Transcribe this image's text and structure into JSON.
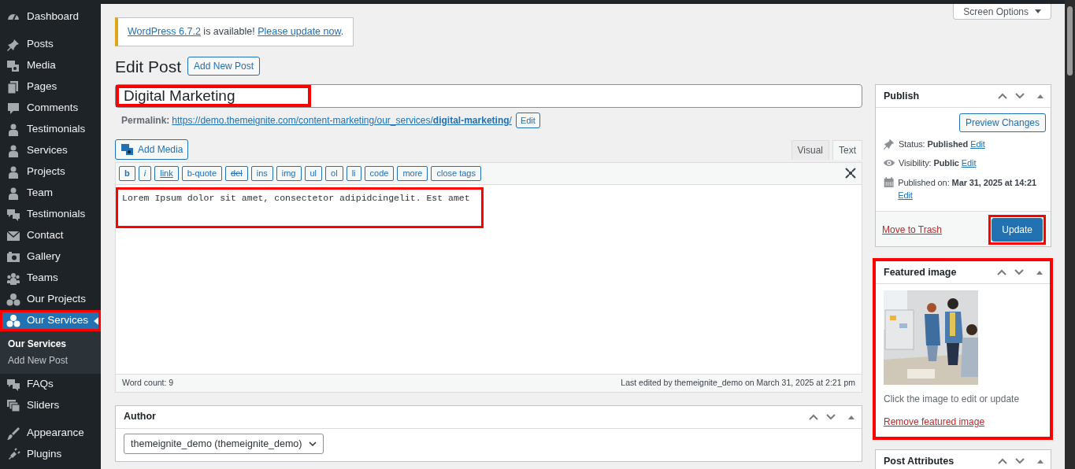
{
  "sidebar": {
    "items": [
      {
        "label": "Dashboard",
        "selected": false,
        "highlighted": false
      },
      {
        "label": "Posts",
        "selected": false,
        "highlighted": false
      },
      {
        "label": "Media",
        "selected": false,
        "highlighted": false
      },
      {
        "label": "Pages",
        "selected": false,
        "highlighted": false
      },
      {
        "label": "Comments",
        "selected": false,
        "highlighted": false
      },
      {
        "label": "Testimonials",
        "selected": false,
        "highlighted": false
      },
      {
        "label": "Services",
        "selected": false,
        "highlighted": false
      },
      {
        "label": "Projects",
        "selected": false,
        "highlighted": false
      },
      {
        "label": "Team",
        "selected": false,
        "highlighted": false
      },
      {
        "label": "Testimonials",
        "selected": false,
        "highlighted": false
      },
      {
        "label": "Contact",
        "selected": false,
        "highlighted": false
      },
      {
        "label": "Gallery",
        "selected": false,
        "highlighted": false
      },
      {
        "label": "Teams",
        "selected": false,
        "highlighted": false
      },
      {
        "label": "Our Projects",
        "selected": false,
        "highlighted": false
      },
      {
        "label": "Our Services",
        "selected": true,
        "highlighted": true,
        "children": [
          {
            "label": "Our Services",
            "selected": true
          },
          {
            "label": "Add New Post",
            "selected": false
          }
        ]
      },
      {
        "label": "FAQs",
        "selected": false,
        "highlighted": false
      },
      {
        "label": "Sliders",
        "selected": false,
        "highlighted": false
      },
      {
        "label": "Appearance",
        "selected": false,
        "highlighted": false
      },
      {
        "label": "Plugins",
        "selected": false,
        "highlighted": false
      }
    ]
  },
  "screen_options": "Screen Options",
  "notice": {
    "link_1": "WordPress 6.7.2",
    "text_1": "is available!",
    "link_2": "Please update now",
    "text_2": "."
  },
  "heading": "Edit Post",
  "add_new_button": "Add New Post",
  "title_field": {
    "value": "Digital Marketing",
    "highlighted": true
  },
  "permalink": {
    "label": "Permalink:",
    "url": "https://demo.themeignite.com/content-marketing/our_services/**digital-marketing**/",
    "edit_button": "Edit"
  },
  "editor": {
    "add_media": "Add Media",
    "tabs": [
      {
        "label": "Visual",
        "selected": false
      },
      {
        "label": "Text",
        "selected": true
      }
    ],
    "quicktags": [
      {
        "label": "b",
        "kind": "bold"
      },
      {
        "label": "i",
        "kind": "italic"
      },
      {
        "label": "link",
        "kind": "underline"
      },
      {
        "label": "b-quote",
        "kind": "plain"
      },
      {
        "label": "del",
        "kind": "strike"
      },
      {
        "label": "ins",
        "kind": "plain"
      },
      {
        "label": "img",
        "kind": "plain"
      },
      {
        "label": "ul",
        "kind": "plain"
      },
      {
        "label": "ol",
        "kind": "plain"
      },
      {
        "label": "li",
        "kind": "plain"
      },
      {
        "label": "code",
        "kind": "plain"
      },
      {
        "label": "more",
        "kind": "plain"
      },
      {
        "label": "close tags",
        "kind": "plain"
      }
    ],
    "content": "Lorem Ipsum dolor sit amet, consectetor adipidcingelit. Est amet",
    "content_highlighted": true,
    "word_count": "Word count: 9",
    "last_edited": "Last edited by themeignite_demo on March 31, 2025 at 2:21 pm"
  },
  "author": {
    "title": "Author",
    "value": "themeignite_demo (themeignite_demo)"
  },
  "publish": {
    "title": "Publish",
    "preview_button": "Preview Changes",
    "rows": [
      {
        "text": "Status: **Published**",
        "edit": "Edit"
      },
      {
        "text": "Visibility: **Public**",
        "edit": "Edit"
      },
      {
        "text": "Published on: **Mar 31, 2025 at 14:21**",
        "edit": "Edit"
      }
    ],
    "trash_link": "Move to Trash",
    "update_button": "Update",
    "update_highlighted": true
  },
  "featured_image": {
    "title": "Featured image",
    "highlighted": true,
    "hint": "Click the image to edit or update",
    "remove_link": "Remove featured image"
  },
  "post_attributes": {
    "title": "Post Attributes"
  }
}
